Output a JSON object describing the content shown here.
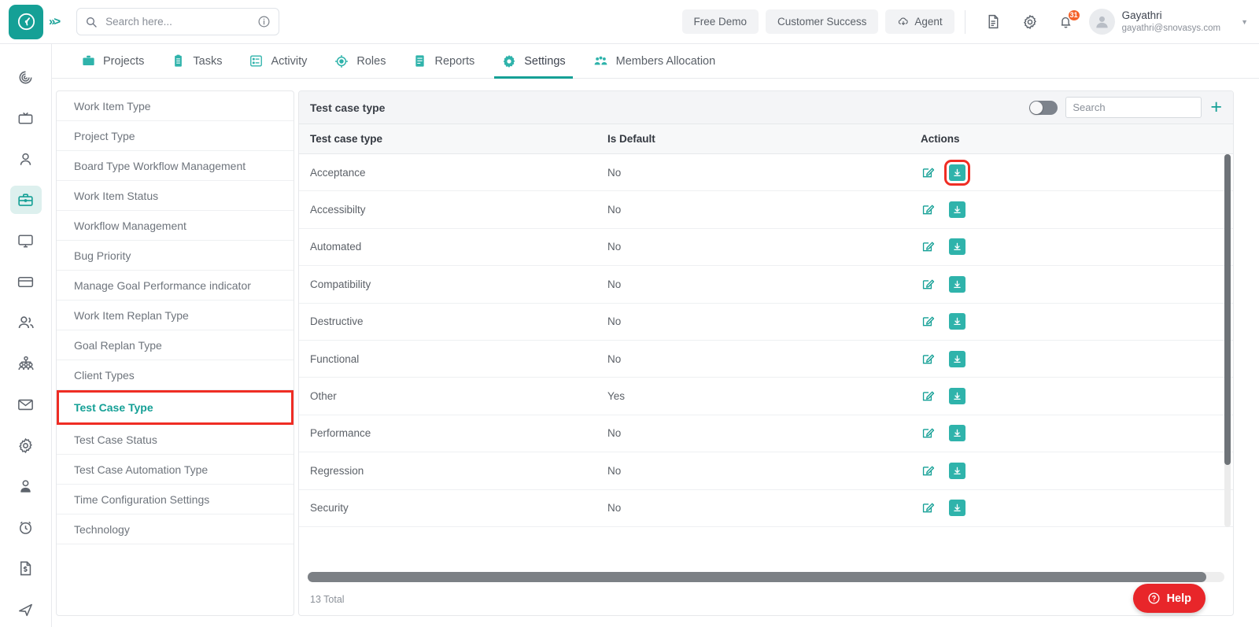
{
  "header": {
    "logo_icon": "clock-logo-icon",
    "expand_icon": "chevrons-right-icon",
    "search": {
      "placeholder": "Search here...",
      "value": "",
      "icon": "search-icon",
      "info_icon": "info-circle-icon"
    },
    "buttons": [
      {
        "label": "Free Demo",
        "name": "free-demo-button"
      },
      {
        "label": "Customer Success",
        "name": "customer-success-button"
      },
      {
        "label": "Agent",
        "name": "agent-button",
        "icon": "cloud-download-icon"
      }
    ],
    "icons": [
      "document-icon",
      "gear-icon",
      "bell-icon"
    ],
    "notification_count": "31",
    "user": {
      "name": "Gayathri",
      "email": "gayathri@snovasys.com",
      "avatar_icon": "user-avatar-icon",
      "caret_icon": "chevron-down-icon"
    }
  },
  "nav_tabs": [
    {
      "label": "Projects",
      "icon": "briefcase-icon",
      "active": false
    },
    {
      "label": "Tasks",
      "icon": "clipboard-icon",
      "active": false
    },
    {
      "label": "Activity",
      "icon": "list-box-icon",
      "active": false
    },
    {
      "label": "Roles",
      "icon": "target-icon",
      "active": false
    },
    {
      "label": "Reports",
      "icon": "report-icon",
      "active": false
    },
    {
      "label": "Settings",
      "icon": "gear-icon",
      "active": true
    },
    {
      "label": "Members Allocation",
      "icon": "people-group-icon",
      "active": false
    }
  ],
  "left_rail": [
    {
      "icon": "spiral-dashboard-icon",
      "active": false
    },
    {
      "icon": "tv-box-icon",
      "active": false
    },
    {
      "icon": "user-icon",
      "active": false
    },
    {
      "icon": "briefcase-icon",
      "active": true
    },
    {
      "icon": "monitor-icon",
      "active": false
    },
    {
      "icon": "credit-card-icon",
      "active": false
    },
    {
      "icon": "users-icon",
      "active": false
    },
    {
      "icon": "org-chart-icon",
      "active": false
    },
    {
      "icon": "mail-icon",
      "active": false
    },
    {
      "icon": "gear-icon",
      "active": false
    },
    {
      "icon": "user-badge-icon",
      "active": false
    },
    {
      "icon": "alarm-clock-icon",
      "active": false
    },
    {
      "icon": "invoice-dollar-icon",
      "active": false
    },
    {
      "icon": "send-paper-plane-icon",
      "active": false
    }
  ],
  "settings_menu": {
    "items": [
      {
        "label": "Work Item Type",
        "selected": false
      },
      {
        "label": "Project Type",
        "selected": false
      },
      {
        "label": "Board Type Workflow Management",
        "selected": false
      },
      {
        "label": "Work Item Status",
        "selected": false
      },
      {
        "label": "Workflow Management",
        "selected": false
      },
      {
        "label": "Bug Priority",
        "selected": false
      },
      {
        "label": "Manage Goal Performance indicator",
        "selected": false
      },
      {
        "label": "Work Item Replan Type",
        "selected": false
      },
      {
        "label": "Goal Replan Type",
        "selected": false
      },
      {
        "label": "Client Types",
        "selected": false
      },
      {
        "label": "Test Case Type",
        "selected": true
      },
      {
        "label": "Test Case Status",
        "selected": false
      },
      {
        "label": "Test Case Automation Type",
        "selected": false
      },
      {
        "label": "Time Configuration Settings",
        "selected": false
      },
      {
        "label": "Technology",
        "selected": false
      }
    ]
  },
  "panel": {
    "title": "Test case type",
    "toggle_on": false,
    "search": {
      "placeholder": "Search",
      "value": ""
    },
    "add_icon": "plus-icon",
    "columns": [
      "Test case type",
      "Is Default",
      "Actions"
    ],
    "rows": [
      {
        "name": "Acceptance",
        "is_default": "No",
        "annotated": true
      },
      {
        "name": "Accessibilty",
        "is_default": "No",
        "annotated": false
      },
      {
        "name": "Automated",
        "is_default": "No",
        "annotated": false
      },
      {
        "name": "Compatibility",
        "is_default": "No",
        "annotated": false
      },
      {
        "name": "Destructive",
        "is_default": "No",
        "annotated": false
      },
      {
        "name": "Functional",
        "is_default": "No",
        "annotated": false
      },
      {
        "name": "Other",
        "is_default": "Yes",
        "annotated": false
      },
      {
        "name": "Performance",
        "is_default": "No",
        "annotated": false
      },
      {
        "name": "Regression",
        "is_default": "No",
        "annotated": false
      },
      {
        "name": "Security",
        "is_default": "No",
        "annotated": false
      }
    ],
    "row_action_icons": {
      "edit": "edit-pencil-icon",
      "download": "download-icon"
    },
    "total_label": "13 Total"
  },
  "help": {
    "label": "Help",
    "icon": "question-circle-icon"
  },
  "colors": {
    "accent": "#15a096",
    "annotation": "#ef2d24",
    "help_red": "#e8262a",
    "badge_orange": "#f4622a"
  }
}
